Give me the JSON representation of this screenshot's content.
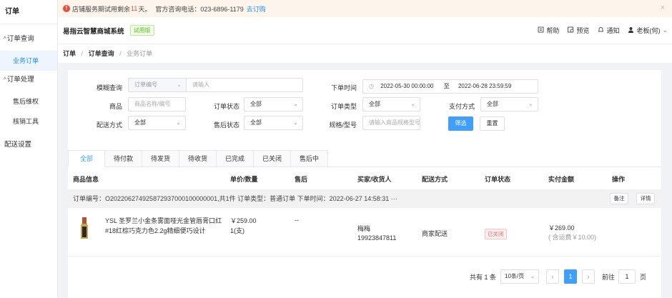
{
  "sidebar": {
    "title": "订单",
    "group1": "订单查询",
    "item_orders": "业务订单",
    "group2": "订单处理",
    "item_after_sale": "售后维权",
    "item_verify": "核销工具",
    "delivery_settings": "配送设置"
  },
  "notice": {
    "prefix": "店铺服务期试用剩余",
    "days": "11",
    "suffix": "天。",
    "hotline": "官方咨询电话：023-6896-1179",
    "link": "去订购",
    "close": "×"
  },
  "header": {
    "system_name": "易指云智慧商城系统",
    "trial_badge": "试用版",
    "help": "帮助",
    "preview": "预览",
    "notify": "通知",
    "user": "老板(何)"
  },
  "breadcrumb": {
    "level1": "订单",
    "level2": "订单查询",
    "level3": "业务订单",
    "sep": "/"
  },
  "filters": {
    "fuzzy_label": "模糊查询",
    "fuzzy_type": "订单编号",
    "fuzzy_placeholder": "请输入",
    "order_time_label": "下单时间",
    "date_start": "2022-05-30 00:00:00",
    "date_to": "至",
    "date_end": "2022-06-28 23:59:59",
    "product_label": "商品",
    "product_placeholder": "商品名称/编号",
    "order_status_label": "订单状态",
    "order_status_value": "全部",
    "order_type_label": "订单类型",
    "order_type_value": "全部",
    "pay_label": "支付方式",
    "pay_value": "全部",
    "delivery_label": "配送方式",
    "delivery_value": "全部",
    "after_sale_label": "售后状态",
    "after_sale_value": "全部",
    "spec_label": "规格/型号",
    "spec_placeholder": "请输入商品规格型号",
    "filter_button": "筛选",
    "reset_button": "重置"
  },
  "tabs": [
    "全部",
    "待付款",
    "待发货",
    "待收货",
    "已完成",
    "已关闭",
    "售后中"
  ],
  "table": {
    "headers": {
      "product": "商品信息",
      "price_qty": "单价/数量",
      "after_sale": "售后",
      "buyer": "买家/收货人",
      "delivery": "配送方式",
      "status": "订单状态",
      "paid": "实付金额",
      "actions": "操作"
    },
    "order_bar": "订单编号：O202206274925872937000100000001,共1件 订单类型：普通订单 下单时间：2022-06-27 14:58:31 ···",
    "note_button": "备注",
    "detail_button": "详情",
    "row": {
      "product_line1": "YSL 圣罗兰小金条雾面哑光金管唇膏口红",
      "product_line2": "#18红棕巧克力色2.2g精细便巧设计",
      "price": "￥259.00",
      "qty": "1(支)",
      "after_sale": "--",
      "buyer_name": "梅梅",
      "buyer_phone": "19923847811",
      "delivery": "商家配送",
      "status": "已关闭",
      "paid": "￥269.00",
      "freight": "( 含运费￥10.00)"
    }
  },
  "pagination": {
    "total": "共有 1 条",
    "page_size": "10条/页",
    "prev": "‹",
    "current": "1",
    "next": "›",
    "goto": "前往",
    "goto_value": "1",
    "page_unit": "页"
  },
  "colors": {
    "primary": "#409eff",
    "danger": "#f56c6c",
    "trial_green": "#52c41a"
  }
}
